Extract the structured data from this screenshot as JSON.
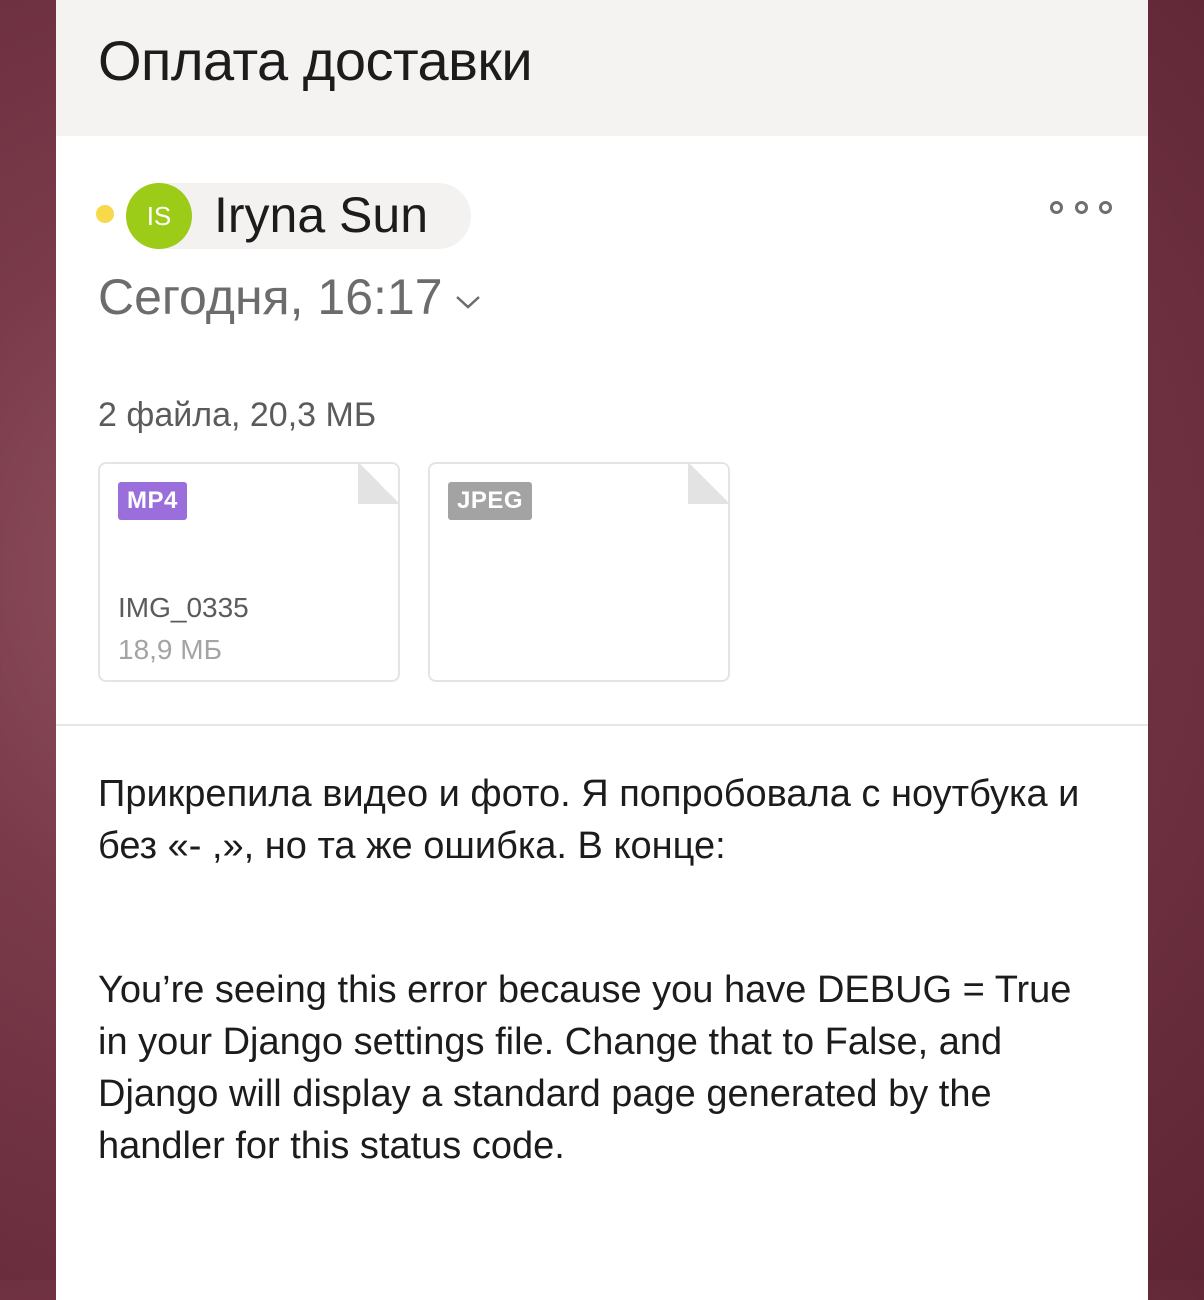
{
  "message": {
    "subject": "Оплата доставки",
    "sender": {
      "initials": "IS",
      "name": "Iryna Sun",
      "avatar_color": "#9ccb18",
      "unread_indicator_color": "#f7d94a"
    },
    "date": "Сегодня, 16:17",
    "more_icon": "more-horizontal-icon",
    "attachments": {
      "summary": "2 файла, 20,3 МБ",
      "files": [
        {
          "type": "MP4",
          "badge_color": "#9a6fdc",
          "name": "IMG_0335",
          "size": "18,9 МБ"
        },
        {
          "type": "JPEG",
          "badge_color": "#a3a3a3",
          "name": "",
          "size": ""
        }
      ]
    },
    "body": {
      "paragraph1": "Прикрепила видео и фото. Я попробовала с ноутбука и без «- ,», но та же ошибка. В конце:",
      "paragraph2": "You’re seeing this error because you have DEBUG = True in your Django settings file. Change that to False, and Django will display a standard page generated by the handler for this status code."
    }
  }
}
